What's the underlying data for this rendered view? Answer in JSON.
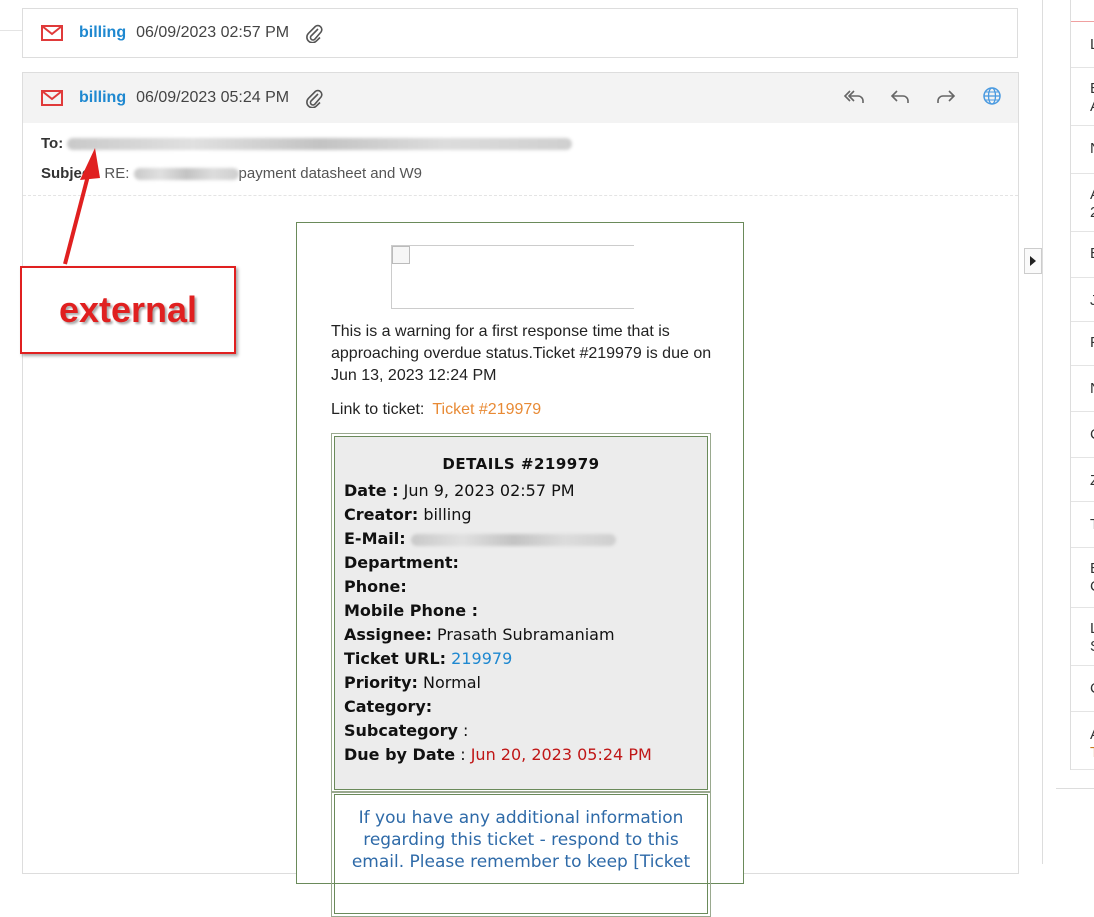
{
  "emails": [
    {
      "sender": "billing",
      "date": "06/09/2023 02:57 PM"
    },
    {
      "sender": "billing",
      "date": "06/09/2023 05:24 PM"
    }
  ],
  "open_email": {
    "to_label": "To:",
    "subject_label": "Subject:",
    "subject_text": "RE: payment datasheet and W9",
    "subject_prefix": "RE:",
    "subject_suffix": "payment datasheet and W9"
  },
  "actions": [
    "reply-all-icon",
    "reply-icon",
    "forward-icon",
    "globe-icon"
  ],
  "annotation": {
    "text": "external",
    "color": "#e02020"
  },
  "ticket": {
    "warning": "This is a warning for a first response time that is approaching overdue status.Ticket #219979 is    due on Jun 13, 2023 12:24 PM",
    "link_label": "Link to ticket:",
    "link_text": "Ticket #219979",
    "details_title": "DETAILS #219979",
    "rows": {
      "date_label": "Date :",
      "date_value": "Jun 9, 2023 02:57 PM",
      "creator_label": "Creator:",
      "creator_value": "billing",
      "email_label": "E-Mail:",
      "department_label": "Department:",
      "phone_label": "Phone:",
      "mobile_label": "Mobile Phone :",
      "assignee_label": "Assignee:",
      "assignee_value": "Prasath Subramaniam",
      "url_label": "Ticket URL:",
      "url_value": "219979",
      "priority_label": "Priority:",
      "priority_value": "Normal",
      "category_label": "Category:",
      "subcategory_label": "Subcategory",
      "subcategory_colon": ":",
      "due_label": "Due by Date",
      "due_colon": ":",
      "due_value": "Jun 20, 2023 05:24 PM"
    },
    "info_text": "If you have any additional information regarding this ticket - respond to this email. Please remember to keep [Ticket"
  },
  "side_letters": [
    "L",
    "E",
    "A",
    "N",
    "A",
    "2",
    "E",
    "J",
    "F",
    "N",
    "C",
    "Z",
    "T",
    "E",
    "C",
    "L",
    "S",
    "C",
    "A",
    "T"
  ],
  "colors": {
    "accent": "#1e88d0",
    "mail_icon": "#e03a3a",
    "link_orange": "#e88a35",
    "due_red": "#c01616"
  }
}
